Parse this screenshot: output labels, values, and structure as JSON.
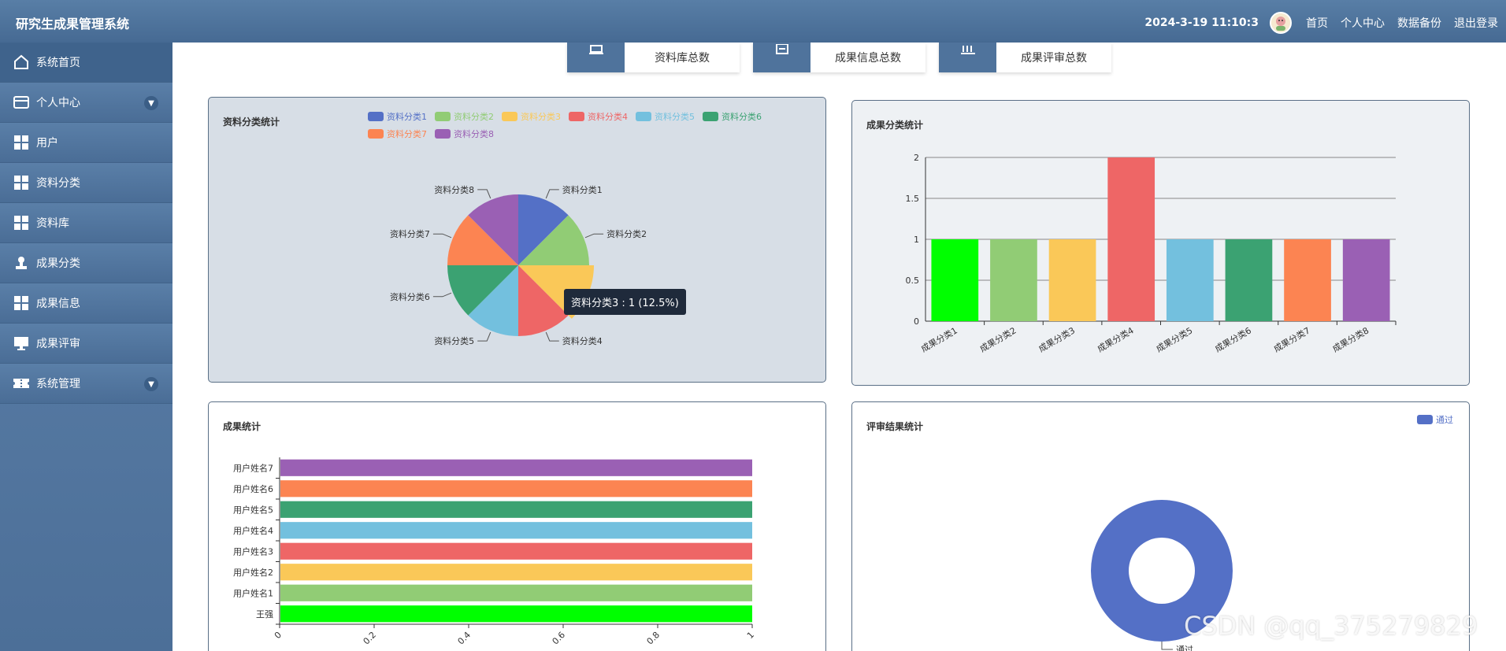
{
  "header": {
    "title": "研究生成果管理系统",
    "datetime": "2024-3-19 11:10:3",
    "links": [
      "首页",
      "个人中心",
      "数据备份",
      "退出登录"
    ]
  },
  "sidebar": {
    "items": [
      {
        "label": "系统首页",
        "icon": "home-icon"
      },
      {
        "label": "个人中心",
        "icon": "card-icon"
      },
      {
        "label": "用户",
        "icon": "grid-icon"
      },
      {
        "label": "资料分类",
        "icon": "grid-icon"
      },
      {
        "label": "资料库",
        "icon": "grid-icon"
      },
      {
        "label": "成果分类",
        "icon": "stamp-icon"
      },
      {
        "label": "成果信息",
        "icon": "grid-icon"
      },
      {
        "label": "成果评审",
        "icon": "monitor-icon"
      },
      {
        "label": "系统管理",
        "icon": "ticket-icon"
      }
    ]
  },
  "stats": [
    {
      "label": "资料库总数",
      "icon": "database-icon"
    },
    {
      "label": "成果信息总数",
      "icon": "document-icon"
    },
    {
      "label": "成果评审总数",
      "icon": "chart-icon"
    }
  ],
  "panels": {
    "pie_title": "资料分类统计",
    "bar_title": "成果分类统计",
    "hbar_title": "成果统计",
    "donut_title": "评审结果统计"
  },
  "tooltip": "资料分类3 : 1 (12.5%)",
  "watermark": "CSDN @qq_375279829",
  "colors": [
    "#5470c6",
    "#91cc75",
    "#fac858",
    "#ee6666",
    "#73c0de",
    "#3ba272",
    "#fc8452",
    "#9a60b4"
  ],
  "chart_data": [
    {
      "type": "pie",
      "title": "资料分类统计",
      "categories": [
        "资料分类1",
        "资料分类2",
        "资料分类3",
        "资料分类4",
        "资料分类5",
        "资料分类6",
        "资料分类7",
        "资料分类8"
      ],
      "values": [
        1,
        1,
        1,
        1,
        1,
        1,
        1,
        1
      ],
      "colors": [
        "#5470c6",
        "#91cc75",
        "#fac858",
        "#ee6666",
        "#73c0de",
        "#3ba272",
        "#fc8452",
        "#9a60b4"
      ],
      "legend": "top-right"
    },
    {
      "type": "bar",
      "title": "成果分类统计",
      "categories": [
        "成果分类1",
        "成果分类2",
        "成果分类3",
        "成果分类4",
        "成果分类5",
        "成果分类6",
        "成果分类7",
        "成果分类8"
      ],
      "values": [
        1,
        1,
        1,
        2,
        1,
        1,
        1,
        1
      ],
      "colors": [
        "#00ff00",
        "#91cc75",
        "#fac858",
        "#ee6666",
        "#73c0de",
        "#3ba272",
        "#fc8452",
        "#9a60b4"
      ],
      "yticks": [
        "0",
        "0.5",
        "1",
        "1.5",
        "2"
      ],
      "ylim": [
        0,
        2
      ],
      "grid": true
    },
    {
      "type": "bar",
      "orientation": "horizontal",
      "title": "成果统计",
      "categories": [
        "王强",
        "用户姓名1",
        "用户姓名2",
        "用户姓名3",
        "用户姓名4",
        "用户姓名5",
        "用户姓名6",
        "用户姓名7"
      ],
      "values": [
        1,
        1,
        1,
        1,
        1,
        1,
        1,
        1
      ],
      "colors": [
        "#00ff00",
        "#91cc75",
        "#fac858",
        "#ee6666",
        "#73c0de",
        "#3ba272",
        "#fc8452",
        "#9a60b4"
      ],
      "xticks": [
        "0",
        "0.2",
        "0.4",
        "0.6",
        "0.8",
        "1"
      ],
      "xlim": [
        0,
        1
      ]
    },
    {
      "type": "pie",
      "variant": "donut",
      "title": "评审结果统计",
      "categories": [
        "通过"
      ],
      "values": [
        1
      ],
      "colors": [
        "#5470c6"
      ],
      "legend": "top-right"
    }
  ]
}
